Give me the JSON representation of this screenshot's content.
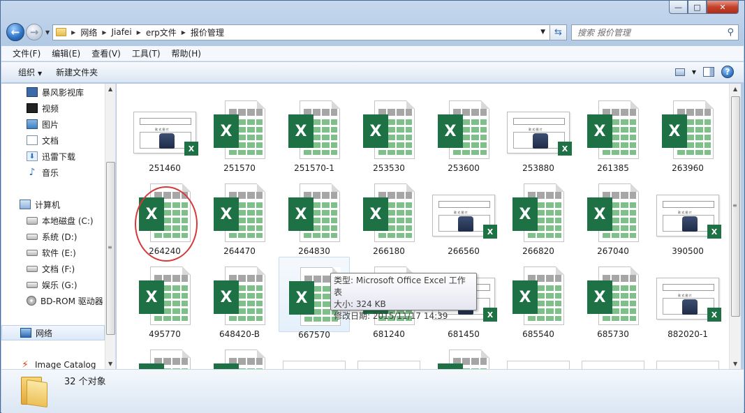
{
  "window": {
    "min_glyph": "—",
    "max_glyph": "□",
    "close_glyph": "✕"
  },
  "address": {
    "crumbs": [
      "网络",
      "Jiafei",
      "erp文件",
      "报价管理"
    ]
  },
  "search": {
    "placeholder": "搜索 报价管理"
  },
  "menu": [
    "文件(F)",
    "编辑(E)",
    "查看(V)",
    "工具(T)",
    "帮助(H)"
  ],
  "toolbar": {
    "organize": "组织",
    "new_folder": "新建文件夹"
  },
  "nav": {
    "items": [
      {
        "label": "暴风影视库",
        "icon": "library-icon"
      },
      {
        "label": "视频",
        "icon": "video-icon"
      },
      {
        "label": "图片",
        "icon": "picture-icon"
      },
      {
        "label": "文档",
        "icon": "document-icon"
      },
      {
        "label": "迅雷下载",
        "icon": "download-icon"
      },
      {
        "label": "音乐",
        "icon": "music-icon"
      },
      {
        "label": "计算机",
        "icon": "computer-icon"
      },
      {
        "label": "本地磁盘 (C:)",
        "icon": "system-drive-icon"
      },
      {
        "label": "系统 (D:)",
        "icon": "drive-icon"
      },
      {
        "label": "软件 (E:)",
        "icon": "drive-icon"
      },
      {
        "label": "文档 (F:)",
        "icon": "drive-icon"
      },
      {
        "label": "娱乐 (G:)",
        "icon": "drive-icon"
      },
      {
        "label": "BD-ROM 驱动器",
        "icon": "disc-drive-icon"
      },
      {
        "label": "网络",
        "icon": "network-icon"
      },
      {
        "label": "Image Catalog",
        "icon": "image-catalog-icon"
      }
    ]
  },
  "files": [
    {
      "name": "251460",
      "kind": "thumb"
    },
    {
      "name": "251570",
      "kind": "excel"
    },
    {
      "name": "251570-1",
      "kind": "excel"
    },
    {
      "name": "253530",
      "kind": "excel"
    },
    {
      "name": "253600",
      "kind": "excel"
    },
    {
      "name": "253880",
      "kind": "thumb"
    },
    {
      "name": "261385",
      "kind": "excel"
    },
    {
      "name": "263960",
      "kind": "excel"
    },
    {
      "name": "264240",
      "kind": "excel"
    },
    {
      "name": "264470",
      "kind": "excel"
    },
    {
      "name": "264830",
      "kind": "excel"
    },
    {
      "name": "266180",
      "kind": "excel"
    },
    {
      "name": "266560",
      "kind": "thumb"
    },
    {
      "name": "266820",
      "kind": "excel"
    },
    {
      "name": "267040",
      "kind": "excel"
    },
    {
      "name": "390500",
      "kind": "thumb"
    },
    {
      "name": "495770",
      "kind": "excel"
    },
    {
      "name": "648420-B",
      "kind": "excel"
    },
    {
      "name": "667570",
      "kind": "excel"
    },
    {
      "name": "681240",
      "kind": "excel"
    },
    {
      "name": "681450",
      "kind": "thumb"
    },
    {
      "name": "685540",
      "kind": "excel"
    },
    {
      "name": "685730",
      "kind": "excel"
    },
    {
      "name": "882020-1",
      "kind": "thumb"
    }
  ],
  "thumb_text": {
    "title": "款 式 图 片"
  },
  "excel_letter": "X",
  "tooltip": {
    "type": "类型: Microsoft Office Excel 工作表",
    "size": "大小: 324 KB",
    "modified": "修改日期: 2015/11/17 14:39"
  },
  "status": {
    "count": "32 个对象"
  },
  "colors": {
    "excel_green": "#1e7145",
    "annotation_red": "#d43a3a"
  }
}
